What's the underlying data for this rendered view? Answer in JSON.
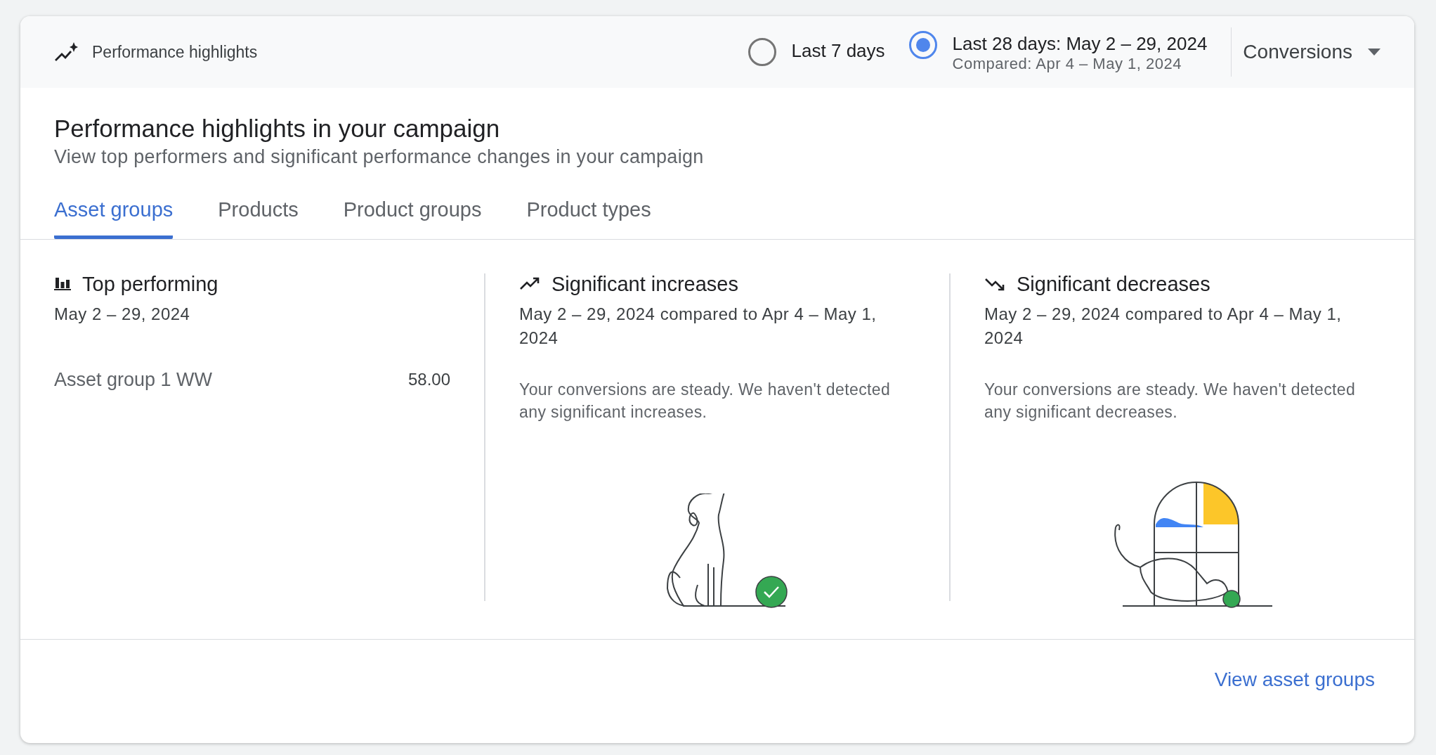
{
  "header": {
    "title": "Performance highlights",
    "ranges": [
      {
        "label": "Last 7 days",
        "selected": false
      },
      {
        "label": "Last 28 days: May 2 – 29, 2024",
        "sublabel": "Compared: Apr 4 – May 1, 2024",
        "selected": true
      }
    ],
    "metric": "Conversions"
  },
  "heading": "Performance highlights in your campaign",
  "subheading": "View top performers and significant performance changes in your campaign",
  "tabs": [
    {
      "label": "Asset groups",
      "selected": true
    },
    {
      "label": "Products",
      "selected": false
    },
    {
      "label": "Product groups",
      "selected": false
    },
    {
      "label": "Product types",
      "selected": false
    }
  ],
  "columns": [
    {
      "kind": "top",
      "title": "Top performing",
      "dates": "May 2 – 29, 2024",
      "rows": [
        {
          "name": "Asset group 1 WW",
          "value": "58.00"
        }
      ]
    },
    {
      "kind": "increase",
      "title": "Significant increases",
      "dates": "May 2 – 29, 2024 compared to Apr 4 – May 1, 2024",
      "message": "Your conversions are steady. We haven't detected any significant increases."
    },
    {
      "kind": "decrease",
      "title": "Significant decreases",
      "dates": "May 2 – 29, 2024 compared to Apr 4 – May 1, 2024",
      "message": "Your conversions are steady. We haven't detected any significant decreases."
    }
  ],
  "footer": {
    "link": "View asset groups"
  }
}
